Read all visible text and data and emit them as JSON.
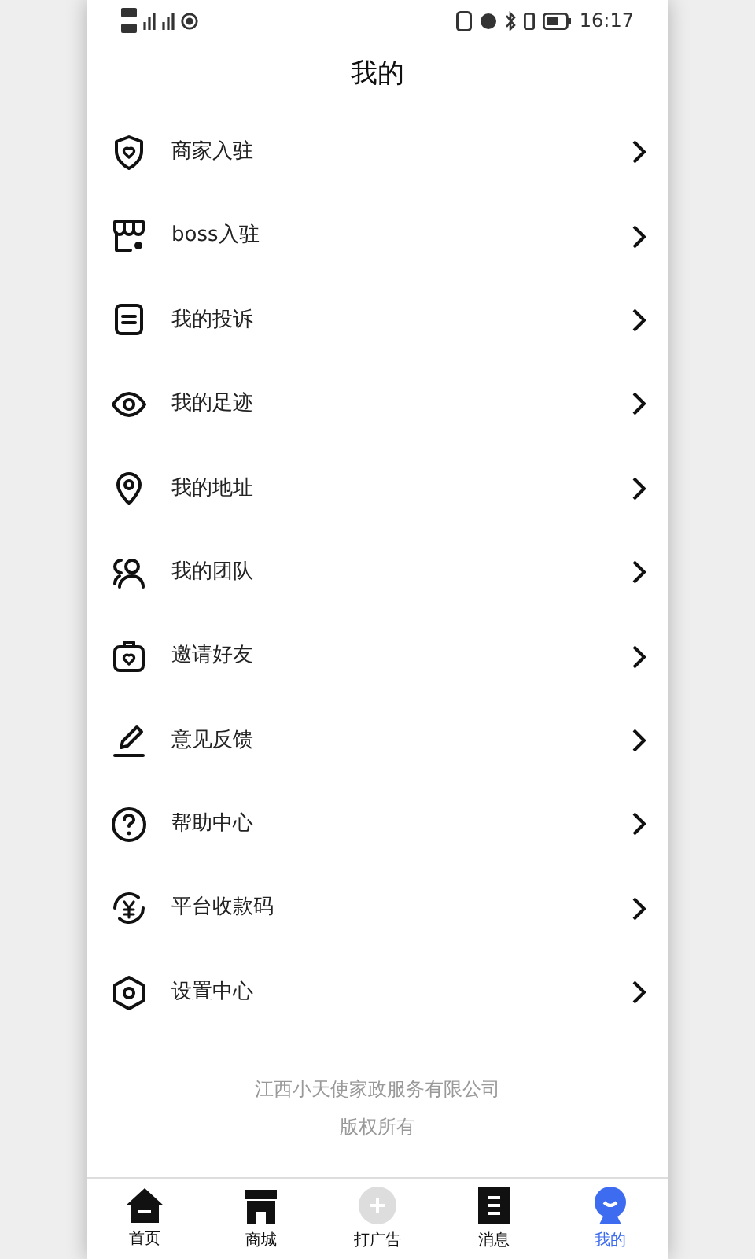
{
  "status_bar": {
    "time": "16:17"
  },
  "header": {
    "title": "我的"
  },
  "menu": [
    {
      "label": "商家入驻"
    },
    {
      "label": "boss入驻"
    },
    {
      "label": "我的投诉"
    },
    {
      "label": "我的足迹"
    },
    {
      "label": "我的地址"
    },
    {
      "label": "我的团队"
    },
    {
      "label": "邀请好友"
    },
    {
      "label": "意见反馈"
    },
    {
      "label": "帮助中心"
    },
    {
      "label": "平台收款码"
    },
    {
      "label": "设置中心"
    }
  ],
  "footer": [
    "江西小天使家政服务有限公司",
    "版权所有"
  ],
  "tab_bar": [
    {
      "label": "首页",
      "selected": false
    },
    {
      "label": "商城",
      "selected": false
    },
    {
      "label": "打广告",
      "selected": false
    },
    {
      "label": "消息",
      "selected": false
    },
    {
      "label": "我的",
      "selected": true
    }
  ]
}
